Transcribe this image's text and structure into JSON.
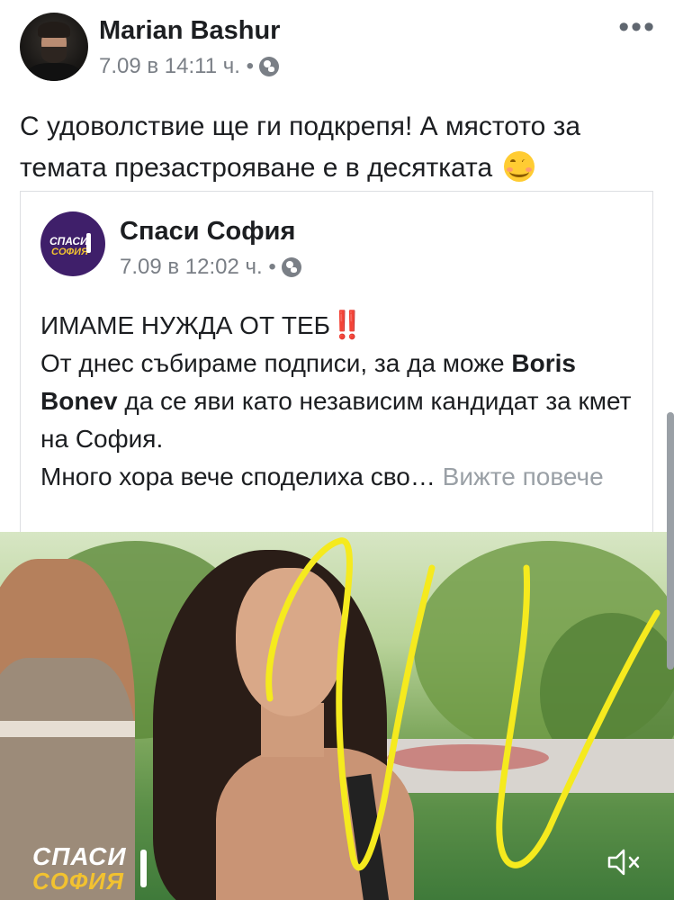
{
  "post": {
    "author": "Marian Bashur",
    "time": "7.09 в 14:11 ч. •",
    "more_label": "•••",
    "text": "С удоволствие ще ги подкрепя! А мястото за темата презастрояване е в десятката"
  },
  "shared": {
    "page_name": "Спаси София",
    "time": "7.09 в 12:02 ч. •",
    "avatar_line1": "СПАСИ",
    "avatar_line2": "СОФИЯ",
    "headline": "ИМАМЕ НУЖДА ОТ ТЕБ",
    "headline_mark": "‼️",
    "line_pre": "От днес събираме подписи, за да може ",
    "line_bold": "Boris Bonev",
    "line_post": " да се яви като независим кандидат за кмет на София.",
    "line_last": "Много хора вече споделиха сво…",
    "see_more": " Вижте повече"
  },
  "video": {
    "logo_line1": "СПАСИ",
    "logo_line2": "СОФИЯ",
    "mute_icon": "speaker-muted-icon"
  },
  "colors": {
    "text": "#1c1e21",
    "meta": "#7a7f86",
    "brand_purple": "#3f1f6a",
    "brand_yellow": "#f2c230",
    "scribble": "#f5ea1e"
  }
}
